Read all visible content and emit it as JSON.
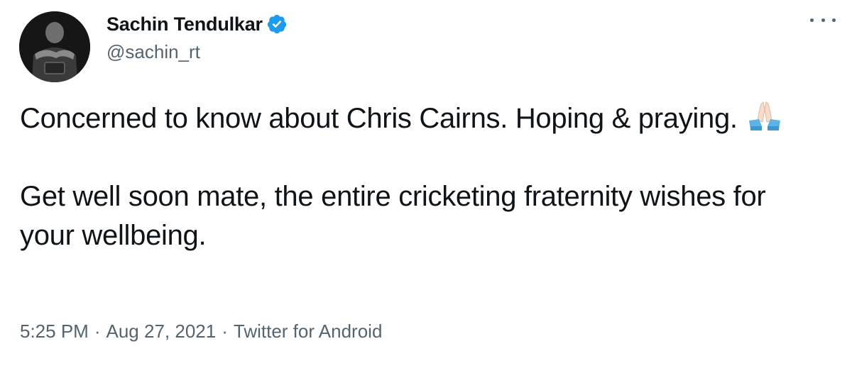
{
  "author": {
    "display_name": "Sachin Tendulkar",
    "handle": "@sachin_rt",
    "verified_icon": "verified-badge-icon",
    "verified_color": "#1d9bf0"
  },
  "menu": {
    "icon": "more-horizontal-icon"
  },
  "tweet": {
    "paragraph_1": "Concerned to know about Chris Cairns. Hoping & praying.",
    "emoji": "folded-hands-emoji",
    "paragraph_2": "Get well soon mate, the entire cricketing fraternity wishes for your wellbeing."
  },
  "meta": {
    "time": "5:25 PM",
    "separator": "·",
    "date": "Aug 27, 2021",
    "source": "Twitter for Android"
  },
  "colors": {
    "text_primary": "#0f1419",
    "text_secondary": "#536471"
  }
}
